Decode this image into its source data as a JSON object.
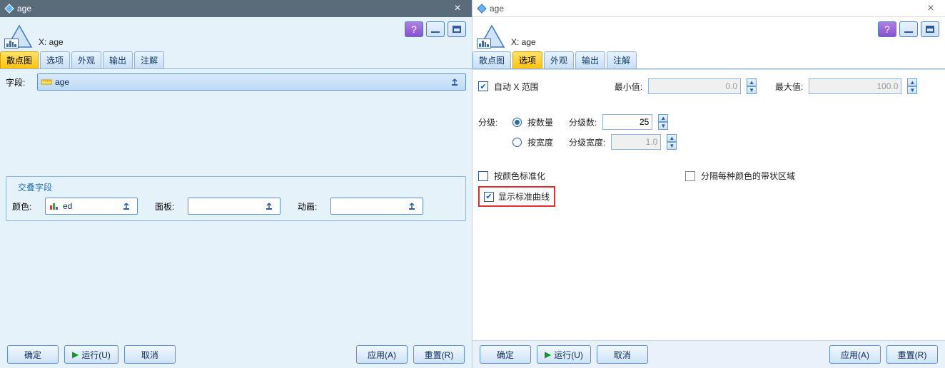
{
  "left": {
    "title": "age",
    "x_label": "X: age",
    "tabs": [
      "散点图",
      "选项",
      "外观",
      "输出",
      "注解"
    ],
    "active_tab": 0,
    "field_label": "字段:",
    "field_value": "age",
    "crossfield_legend": "交叠字段",
    "color_label": "颜色:",
    "color_value": "ed",
    "panel_label": "面板:",
    "panel_value": "",
    "anim_label": "动画:",
    "anim_value": "",
    "buttons": {
      "ok": "确定",
      "run": "运行(U)",
      "cancel": "取消",
      "apply": "应用(A)",
      "reset": "重置(R)"
    }
  },
  "right": {
    "title": "age",
    "x_label": "X: age",
    "tabs": [
      "散点图",
      "选项",
      "外观",
      "输出",
      "注解"
    ],
    "active_tab": 1,
    "auto_x_range": {
      "checked": true,
      "label": "自动 X 范围"
    },
    "min_label": "最小值:",
    "min_value": "0.0",
    "max_label": "最大值:",
    "max_value": "100.0",
    "binning_label": "分级:",
    "by_count": {
      "selected": true,
      "label": "按数量"
    },
    "bin_count_label": "分级数:",
    "bin_count_value": "25",
    "by_width": {
      "selected": false,
      "label": "按宽度"
    },
    "bin_width_label": "分级宽度:",
    "bin_width_value": "1.0",
    "normalize_by_color": {
      "checked": false,
      "label": "按颜色标准化"
    },
    "separate_bands": {
      "checked": false,
      "label": "分隔每种颜色的带状区域"
    },
    "show_normal_curve": {
      "checked": true,
      "label": "显示标准曲线"
    },
    "buttons": {
      "ok": "确定",
      "run": "运行(U)",
      "cancel": "取消",
      "apply": "应用(A)",
      "reset": "重置(R)"
    }
  }
}
